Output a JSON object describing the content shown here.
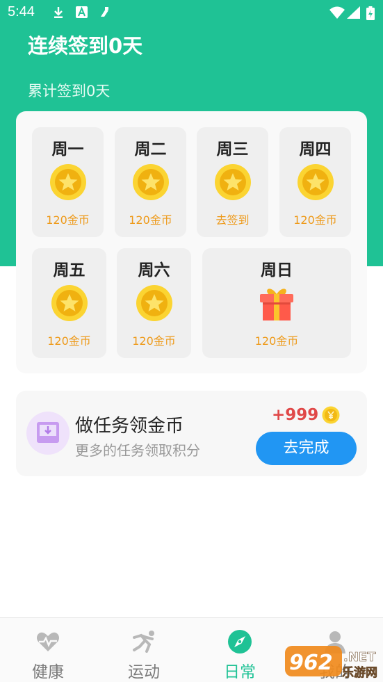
{
  "status_bar": {
    "time": "5:44"
  },
  "header": {
    "title": "连续签到0天",
    "subtitle": "累计签到0天"
  },
  "checkin": {
    "days": [
      {
        "label": "周一",
        "reward": "120金币",
        "icon": "gold-coin-icon"
      },
      {
        "label": "周二",
        "reward": "120金币",
        "icon": "gold-coin-icon"
      },
      {
        "label": "周三",
        "reward": "去签到",
        "icon": "gold-coin-icon"
      },
      {
        "label": "周四",
        "reward": "120金币",
        "icon": "gold-coin-icon"
      },
      {
        "label": "周五",
        "reward": "120金币",
        "icon": "gold-coin-icon"
      },
      {
        "label": "周六",
        "reward": "120金币",
        "icon": "gold-coin-icon"
      },
      {
        "label": "周日",
        "reward": "120金币",
        "icon": "gift-box-icon"
      }
    ]
  },
  "task": {
    "title": "做任务领金币",
    "subtitle": "更多的任务领取积分",
    "reward": "+999",
    "button": "去完成"
  },
  "tabs": [
    {
      "label": "健康",
      "icon": "heart-pulse-icon",
      "active": false
    },
    {
      "label": "运动",
      "icon": "running-icon",
      "active": false
    },
    {
      "label": "日常",
      "icon": "compass-icon",
      "active": true
    },
    {
      "label": "我的",
      "icon": "person-icon",
      "active": false
    }
  ],
  "watermark": {
    "text": "962.NET",
    "sub": "乐游网"
  },
  "colors": {
    "primary": "#1fc295",
    "coin": "#f7c21a",
    "reward_text": "#ee9a1a",
    "button": "#2196f3",
    "reward_red": "#e04848"
  }
}
